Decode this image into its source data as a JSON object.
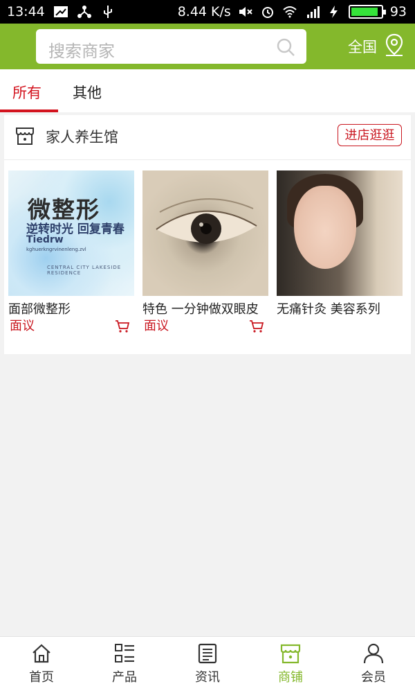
{
  "status_bar": {
    "time": "13:44",
    "speed": "8.44 K/s",
    "battery": "93",
    "icons": [
      "screenshot-icon",
      "usb-share-icon",
      "usb-icon",
      "mute-icon",
      "alarm-icon",
      "wifi-icon",
      "4g-signal-icon",
      "charging-icon",
      "battery-icon"
    ]
  },
  "header": {
    "search_placeholder": "搜索商家",
    "region_label": "全国",
    "accent_color": "#84b82c"
  },
  "tabs": [
    {
      "label": "所有",
      "active": true
    },
    {
      "label": "其他",
      "active": false
    }
  ],
  "shop": {
    "name": "家人养生馆",
    "visit_button": "进店逛逛"
  },
  "products": [
    {
      "title": "面部微整形",
      "price": "面议",
      "image_text": {
        "line1": "微整形",
        "line2": "逆转时光 回复青春",
        "line3": "Tiedrw",
        "line4": "kghuerkngrvinenleng.zvl",
        "line5": "CENTRAL CITY LAKESIDE RESIDENCE"
      }
    },
    {
      "title": "特色 一分钟做双眼皮",
      "price": "面议"
    },
    {
      "title": "无痛针灸 美容系列",
      "price": ""
    }
  ],
  "bottom_nav": [
    {
      "label": "首页",
      "icon": "home-icon",
      "active": false
    },
    {
      "label": "产品",
      "icon": "list-grid-icon",
      "active": false
    },
    {
      "label": "资讯",
      "icon": "news-icon",
      "active": false
    },
    {
      "label": "商铺",
      "icon": "store-icon",
      "active": true
    },
    {
      "label": "会员",
      "icon": "user-icon",
      "active": false
    }
  ]
}
